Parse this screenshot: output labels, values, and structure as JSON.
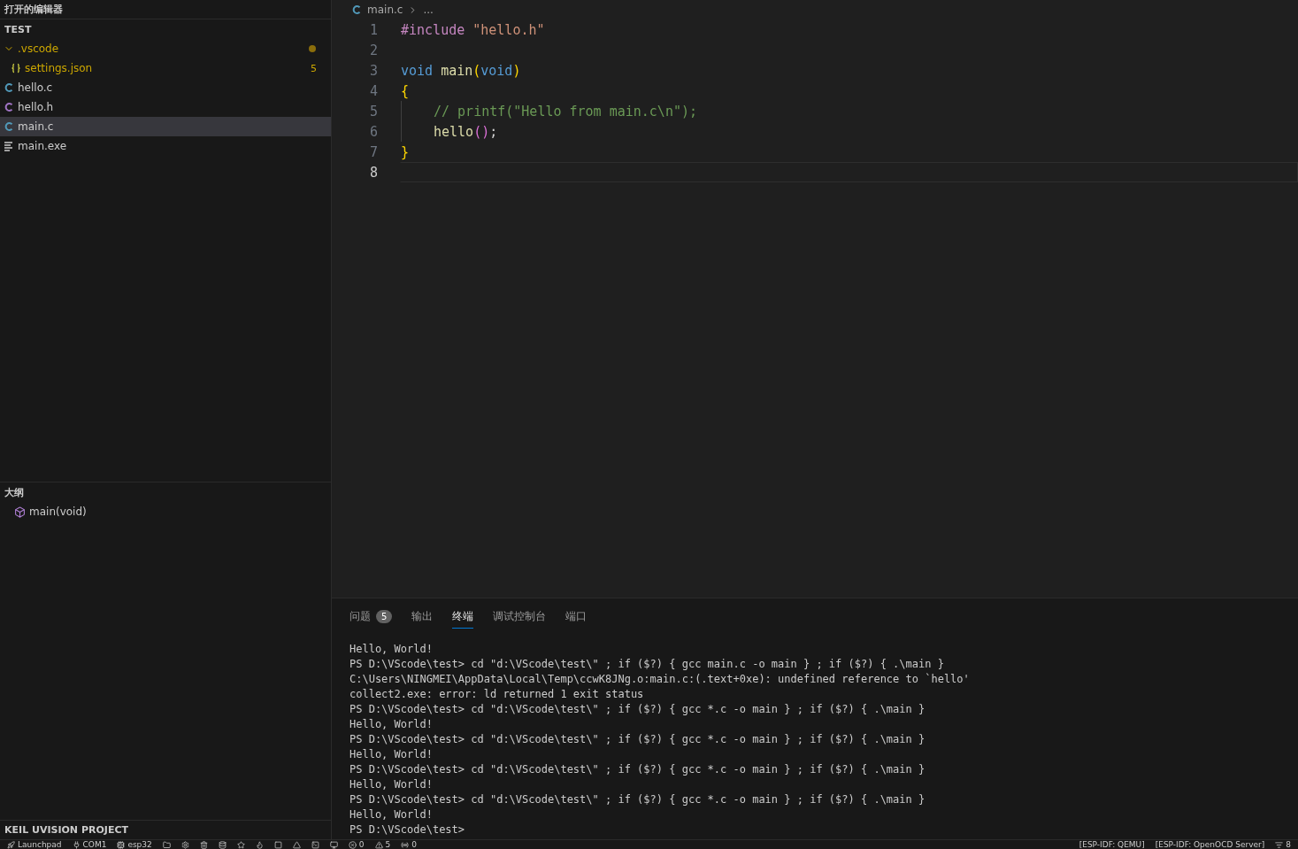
{
  "sidebar": {
    "open_editors_title": "打开的编辑器",
    "explorer": {
      "title": "TEST",
      "items": [
        {
          "kind": "folder",
          "label": ".vscode",
          "expanded": true,
          "modified": true,
          "children": [
            {
              "kind": "json",
              "label": "settings.json",
              "badge": "5",
              "selected": false
            }
          ]
        },
        {
          "kind": "c",
          "label": "hello.c",
          "selected": false
        },
        {
          "kind": "h",
          "label": "hello.h",
          "selected": false
        },
        {
          "kind": "c",
          "label": "main.c",
          "selected": true
        },
        {
          "kind": "exe",
          "label": "main.exe",
          "selected": false
        }
      ]
    },
    "outline": {
      "title": "大纲",
      "items": [
        {
          "label": "main(void)"
        }
      ]
    },
    "keil_title": "KEIL UVISION PROJECT"
  },
  "editor": {
    "breadcrumb": {
      "file": "main.c",
      "rest": "..."
    },
    "lines": [
      {
        "number": "1",
        "current": false,
        "indent": false,
        "tokens": [
          {
            "kind": "directive",
            "text": "#include"
          },
          {
            "kind": "string",
            "text": "\"hello.h\"",
            "space_before": true
          }
        ]
      },
      {
        "number": "2",
        "current": false,
        "indent": false
      },
      {
        "number": "3",
        "current": false,
        "indent": false,
        "tokens": [
          {
            "kind": "keyword",
            "text": "void"
          },
          {
            "kind": "func",
            "text": "main",
            "space_before": true
          },
          {
            "kind": "bracket1",
            "text": "("
          },
          {
            "kind": "keyword",
            "text": "void"
          },
          {
            "kind": "bracket1",
            "text": ")"
          }
        ]
      },
      {
        "number": "4",
        "current": false,
        "indent": false,
        "tokens": [
          {
            "kind": "bracket1",
            "text": "{"
          }
        ]
      },
      {
        "number": "5",
        "current": false,
        "indent": true,
        "tokens": [
          {
            "kind": "comment",
            "text": "// printf(\"Hello from main.c\\n\");"
          }
        ]
      },
      {
        "number": "6",
        "current": false,
        "indent": true,
        "tokens": [
          {
            "kind": "func",
            "text": "hello"
          },
          {
            "kind": "bracket2",
            "text": "()"
          },
          {
            "kind": "plain",
            "text": ";"
          }
        ]
      },
      {
        "number": "7",
        "current": false,
        "indent": false,
        "tokens": [
          {
            "kind": "bracket1",
            "text": "}"
          }
        ]
      },
      {
        "number": "8",
        "current": true,
        "indent": false
      }
    ]
  },
  "panel": {
    "tabs": [
      {
        "label": "问题",
        "badge": "5",
        "selected": false
      },
      {
        "label": "输出",
        "selected": false
      },
      {
        "label": "终端",
        "selected": true
      },
      {
        "label": "调试控制台",
        "selected": false
      },
      {
        "label": "端口",
        "selected": false
      }
    ],
    "terminal_lines": [
      "Hello, World!",
      "PS D:\\VScode\\test> cd \"d:\\VScode\\test\\\" ; if ($?) { gcc main.c -o main } ; if ($?) { .\\main }",
      "C:\\Users\\NINGMEI\\AppData\\Local\\Temp\\ccwK8JNg.o:main.c:(.text+0xe): undefined reference to `hello'",
      "collect2.exe: error: ld returned 1 exit status",
      "PS D:\\VScode\\test> cd \"d:\\VScode\\test\\\" ; if ($?) { gcc *.c -o main } ; if ($?) { .\\main }",
      "Hello, World!",
      "PS D:\\VScode\\test> cd \"d:\\VScode\\test\\\" ; if ($?) { gcc *.c -o main } ; if ($?) { .\\main }",
      "Hello, World!",
      "PS D:\\VScode\\test> cd \"d:\\VScode\\test\\\" ; if ($?) { gcc *.c -o main } ; if ($?) { .\\main }",
      "Hello, World!",
      "PS D:\\VScode\\test> cd \"d:\\VScode\\test\\\" ; if ($?) { gcc *.c -o main } ; if ($?) { .\\main }",
      "Hello, World!",
      "PS D:\\VScode\\test>"
    ]
  },
  "status_bar": {
    "left": [
      {
        "kind": "launch",
        "text": "Launchpad"
      },
      {
        "kind": "port",
        "text": "COM1"
      },
      {
        "kind": "target",
        "text": "esp32"
      },
      {
        "kind": "open"
      },
      {
        "kind": "config"
      },
      {
        "kind": "clean"
      },
      {
        "kind": "flash"
      },
      {
        "kind": "favorite"
      },
      {
        "kind": "build"
      },
      {
        "kind": "stop"
      },
      {
        "kind": "debug"
      },
      {
        "kind": "shell"
      },
      {
        "kind": "monitor"
      },
      {
        "kind": "errors",
        "text": "0"
      },
      {
        "kind": "warnings",
        "text": "5"
      },
      {
        "kind": "ports",
        "text": "0"
      }
    ],
    "right": [
      {
        "text": "[ESP-IDF: QEMU]"
      },
      {
        "text": "[ESP-IDF: OpenOCD Server]"
      },
      {
        "kind": "notifications",
        "text": "8"
      }
    ]
  }
}
